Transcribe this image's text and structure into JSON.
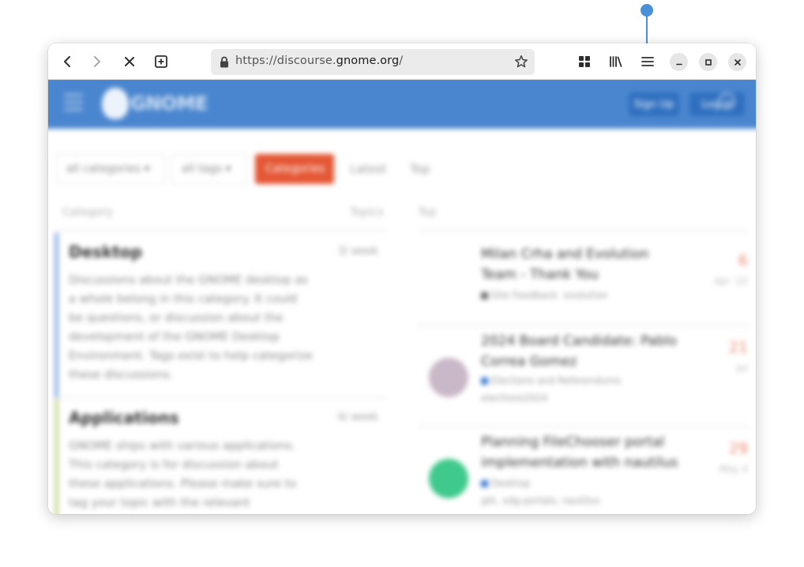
{
  "colors": {
    "accent": "#4a90d9",
    "site_header": "#4a86cf",
    "categories_button": "#e45735",
    "desktop_bar": "#8fb3e8",
    "applications_bar": "#c8dba0"
  },
  "toolbar": {
    "back_icon": "chevron-left-icon",
    "forward_icon": "chevron-right-icon",
    "stop_icon": "close-icon",
    "new_tab_icon": "plus-square-icon",
    "url_prefix": "https://discourse.",
    "url_host": "gnome.org",
    "url_suffix": "/",
    "bookmark_icon": "star-icon",
    "grid_icon": "grid-icon",
    "library_icon": "library-icon",
    "menu_icon": "hamburger-menu-icon"
  },
  "window_controls": {
    "minimize_icon": "minimize-icon",
    "maximize_icon": "maximize-icon",
    "close_icon": "close-icon"
  },
  "site": {
    "logo_text": "GNOME",
    "signup_label": "Sign Up",
    "login_label": "Log In",
    "nav": {
      "categories_filter": "all categories",
      "tags_filter": "all tags",
      "categories": "Categories",
      "latest": "Latest",
      "top": "Top"
    },
    "columns": {
      "category": "Category",
      "topics": "Topics",
      "top": "Top"
    },
    "categories": [
      {
        "title": "Desktop",
        "count": "3/ week",
        "desc": "Discussions about the GNOME desktop as a whole belong in this category. It could be questions, or discussion about the development of the GNOME Desktop Environment. Tags exist to help categorize these discussions."
      },
      {
        "title": "Applications",
        "count": "6/ week",
        "desc": "GNOME ships with various applications. This category is for discussion about these applications. Please make sure to tag your topic with the relevant"
      }
    ],
    "topics": [
      {
        "title": "Milan Crha and Evolution Team - Thank You",
        "meta1": "Site Feedback",
        "meta2": "evolution",
        "count": "6",
        "ago": "Apr '22"
      },
      {
        "title": "2024 Board Candidate: Pablo Correa Gomez",
        "meta1": "Elections and Referendums",
        "meta2": "elections2024",
        "count": "21",
        "ago": "Jul"
      },
      {
        "title": "Planning FileChooser portal implementation with nautilus",
        "meta1": "Desktop",
        "meta2": "gtk, xdg-portals, nautilus",
        "count": "29",
        "ago": "May 4"
      }
    ]
  }
}
